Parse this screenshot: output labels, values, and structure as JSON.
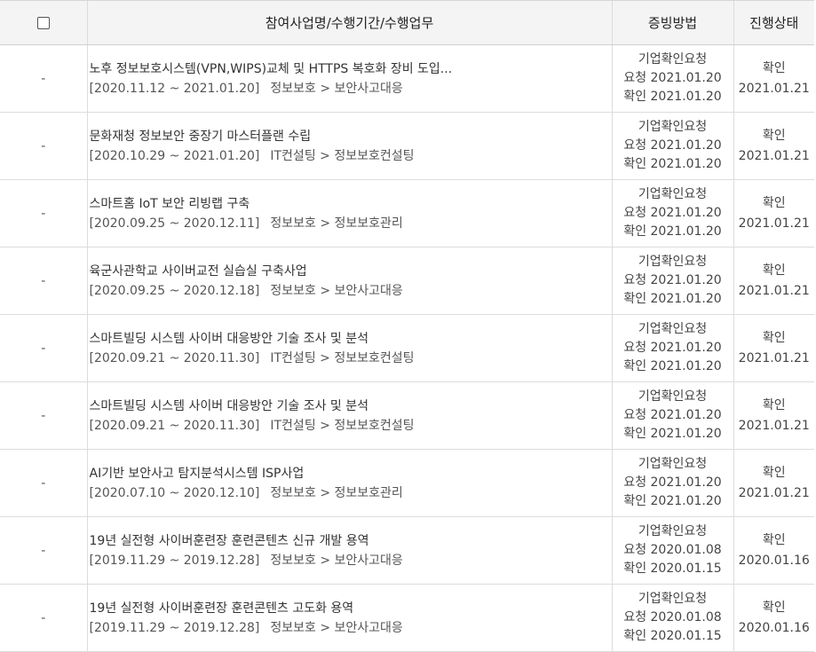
{
  "header": {
    "col2": "참여사업명/수행기간/수행업무",
    "col3": "증빙방법",
    "col4": "진행상태"
  },
  "rows": [
    {
      "dash": "-",
      "title": "노후 정보보호시스템(VPN,WIPS)교체 및 HTTPS 복호화 장비 도입...",
      "period": "[2020.11.12 ~ 2021.01.20]",
      "task": "정보보호 > 보안사고대응",
      "proof_method": "기업확인요청",
      "req": "요청 2021.01.20",
      "conf": "확인 2021.01.20",
      "status": "확인",
      "status_date": "2021.01.21"
    },
    {
      "dash": "-",
      "title": "문화재청 정보보안 중장기 마스터플랜 수립",
      "period": "[2020.10.29 ~ 2021.01.20]",
      "task": "IT컨설팅 > 정보보호컨설팅",
      "proof_method": "기업확인요청",
      "req": "요청 2021.01.20",
      "conf": "확인 2021.01.20",
      "status": "확인",
      "status_date": "2021.01.21"
    },
    {
      "dash": "-",
      "title": "스마트홈 IoT 보안 리빙랩 구축",
      "period": "[2020.09.25 ~ 2020.12.11]",
      "task": "정보보호 > 정보보호관리",
      "proof_method": "기업확인요청",
      "req": "요청 2021.01.20",
      "conf": "확인 2021.01.20",
      "status": "확인",
      "status_date": "2021.01.21"
    },
    {
      "dash": "-",
      "title": "육군사관학교 사이버교전 실습실 구축사업",
      "period": "[2020.09.25 ~ 2020.12.18]",
      "task": "정보보호 > 보안사고대응",
      "proof_method": "기업확인요청",
      "req": "요청 2021.01.20",
      "conf": "확인 2021.01.20",
      "status": "확인",
      "status_date": "2021.01.21"
    },
    {
      "dash": "-",
      "title": "스마트빌딩 시스템 사이버 대응방안 기술 조사 및 분석",
      "period": "[2020.09.21 ~ 2020.11.30]",
      "task": "IT컨설팅 > 정보보호컨설팅",
      "proof_method": "기업확인요청",
      "req": "요청 2021.01.20",
      "conf": "확인 2021.01.20",
      "status": "확인",
      "status_date": "2021.01.21"
    },
    {
      "dash": "-",
      "title": "스마트빌딩 시스템 사이버 대응방안 기술 조사 및 분석",
      "period": "[2020.09.21 ~ 2020.11.30]",
      "task": "IT컨설팅 > 정보보호컨설팅",
      "proof_method": "기업확인요청",
      "req": "요청 2021.01.20",
      "conf": "확인 2021.01.20",
      "status": "확인",
      "status_date": "2021.01.21"
    },
    {
      "dash": "-",
      "title": "AI기반 보안사고 탐지분석시스템 ISP사업",
      "period": "[2020.07.10 ~ 2020.12.10]",
      "task": "정보보호 > 정보보호관리",
      "proof_method": "기업확인요청",
      "req": "요청 2021.01.20",
      "conf": "확인 2021.01.20",
      "status": "확인",
      "status_date": "2021.01.21"
    },
    {
      "dash": "-",
      "title": "19년 실전형 사이버훈련장 훈련콘텐츠 신규 개발 용역",
      "period": "[2019.11.29 ~ 2019.12.28]",
      "task": "정보보호 > 보안사고대응",
      "proof_method": "기업확인요청",
      "req": "요청 2020.01.08",
      "conf": "확인 2020.01.15",
      "status": "확인",
      "status_date": "2020.01.16"
    },
    {
      "dash": "-",
      "title": "19년 실전형 사이버훈련장 훈련콘텐츠 고도화 용역",
      "period": "[2019.11.29 ~ 2019.12.28]",
      "task": "정보보호 > 보안사고대응",
      "proof_method": "기업확인요청",
      "req": "요청 2020.01.08",
      "conf": "확인 2020.01.15",
      "status": "확인",
      "status_date": "2020.01.16"
    }
  ]
}
